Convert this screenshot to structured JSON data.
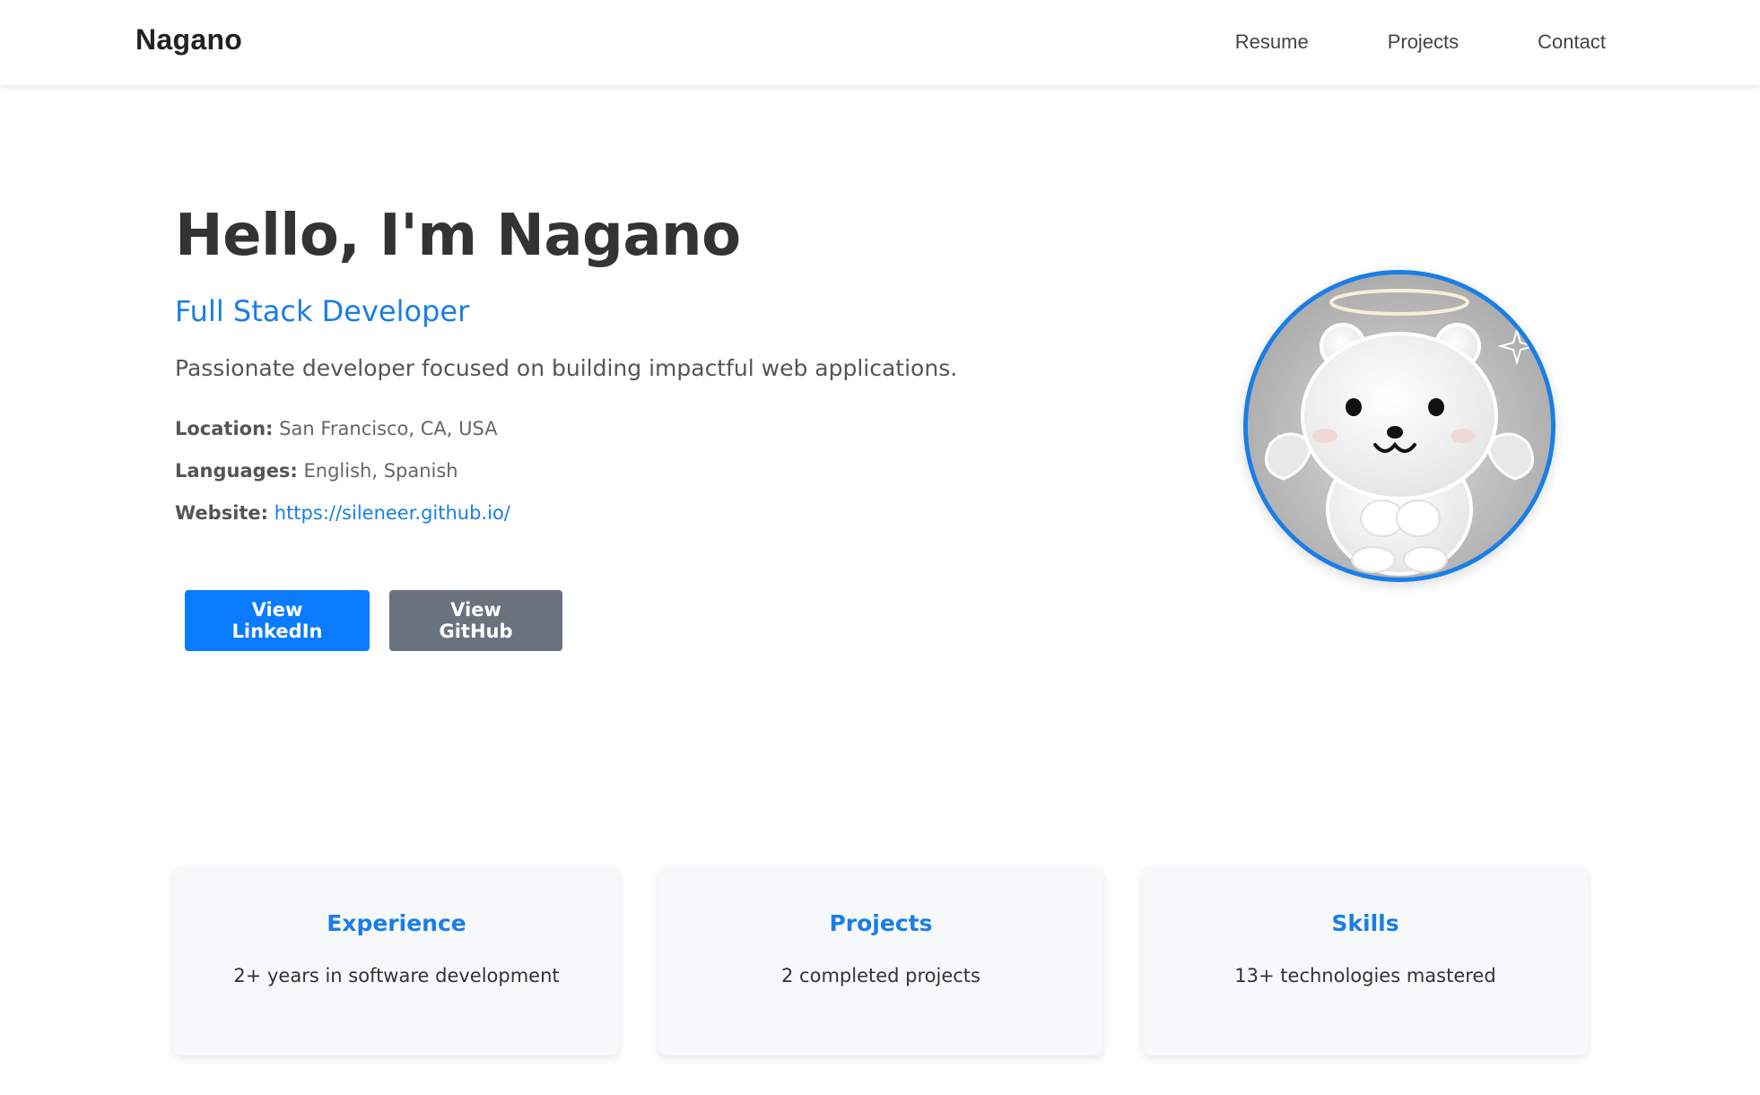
{
  "header": {
    "brand": "Nagano",
    "nav": [
      {
        "label": "Resume"
      },
      {
        "label": "Projects"
      },
      {
        "label": "Contact"
      }
    ]
  },
  "hero": {
    "title": "Hello, I'm Nagano",
    "subtitle": "Full Stack Developer",
    "description": "Passionate developer focused on building impactful web applications.",
    "info": {
      "location": {
        "key": "Location:",
        "value": "San Francisco, CA, USA"
      },
      "languages": {
        "key": "Languages:",
        "value": "English, Spanish"
      },
      "website": {
        "key": "Website:",
        "value": "https://sileneer.github.io/"
      }
    },
    "buttons": {
      "linkedin": "View LinkedIn",
      "github": "View GitHub"
    }
  },
  "avatar": {
    "icon": "angel-bear-avatar",
    "border_color": "#1a7ee6"
  },
  "stats": [
    {
      "title": "Experience",
      "text": "2+ years in software development"
    },
    {
      "title": "Projects",
      "text": "2 completed projects"
    },
    {
      "title": "Skills",
      "text": "13+ technologies mastered"
    }
  ],
  "colors": {
    "accent": "#1a7ee6",
    "primary_button": "#0a7bff",
    "secondary_button": "#6a737d",
    "text": "#333333"
  }
}
